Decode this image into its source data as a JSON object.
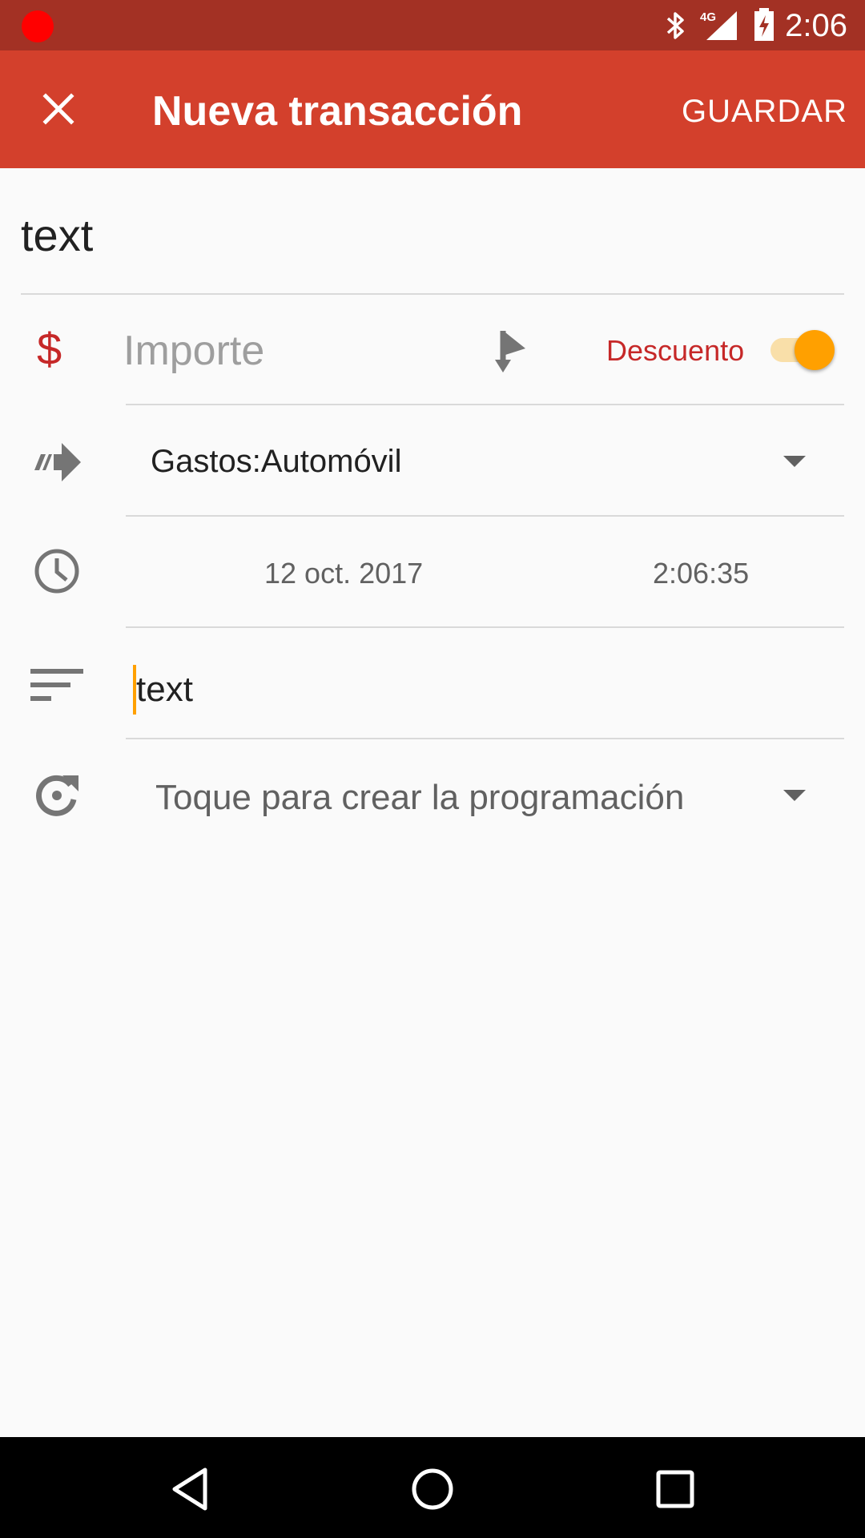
{
  "status_bar": {
    "time": "2:06",
    "network": "4G",
    "icons": [
      "record-dot-icon",
      "bluetooth-icon",
      "signal-icon",
      "battery-charging-icon"
    ]
  },
  "app_bar": {
    "title": "Nueva transacción",
    "save_label": "GUARDAR",
    "close_icon": "close-icon"
  },
  "form": {
    "description_value": "text",
    "currency_symbol": "$",
    "amount_placeholder": "Importe",
    "split_icon": "split-icon",
    "discount_label": "Descuento",
    "discount_enabled": true,
    "account_value": "Gastos:Automóvil",
    "date": "12 oct. 2017",
    "time": "2:06:35",
    "notes_value": "text",
    "schedule_placeholder": "Toque para crear la programación"
  },
  "colors": {
    "status_bar": "#a33124",
    "app_bar": "#d3402c",
    "accent": "#ffa000",
    "debit_red": "#c62828"
  },
  "nav_bar": {
    "icons": [
      "back-icon",
      "home-icon",
      "recents-icon"
    ]
  }
}
